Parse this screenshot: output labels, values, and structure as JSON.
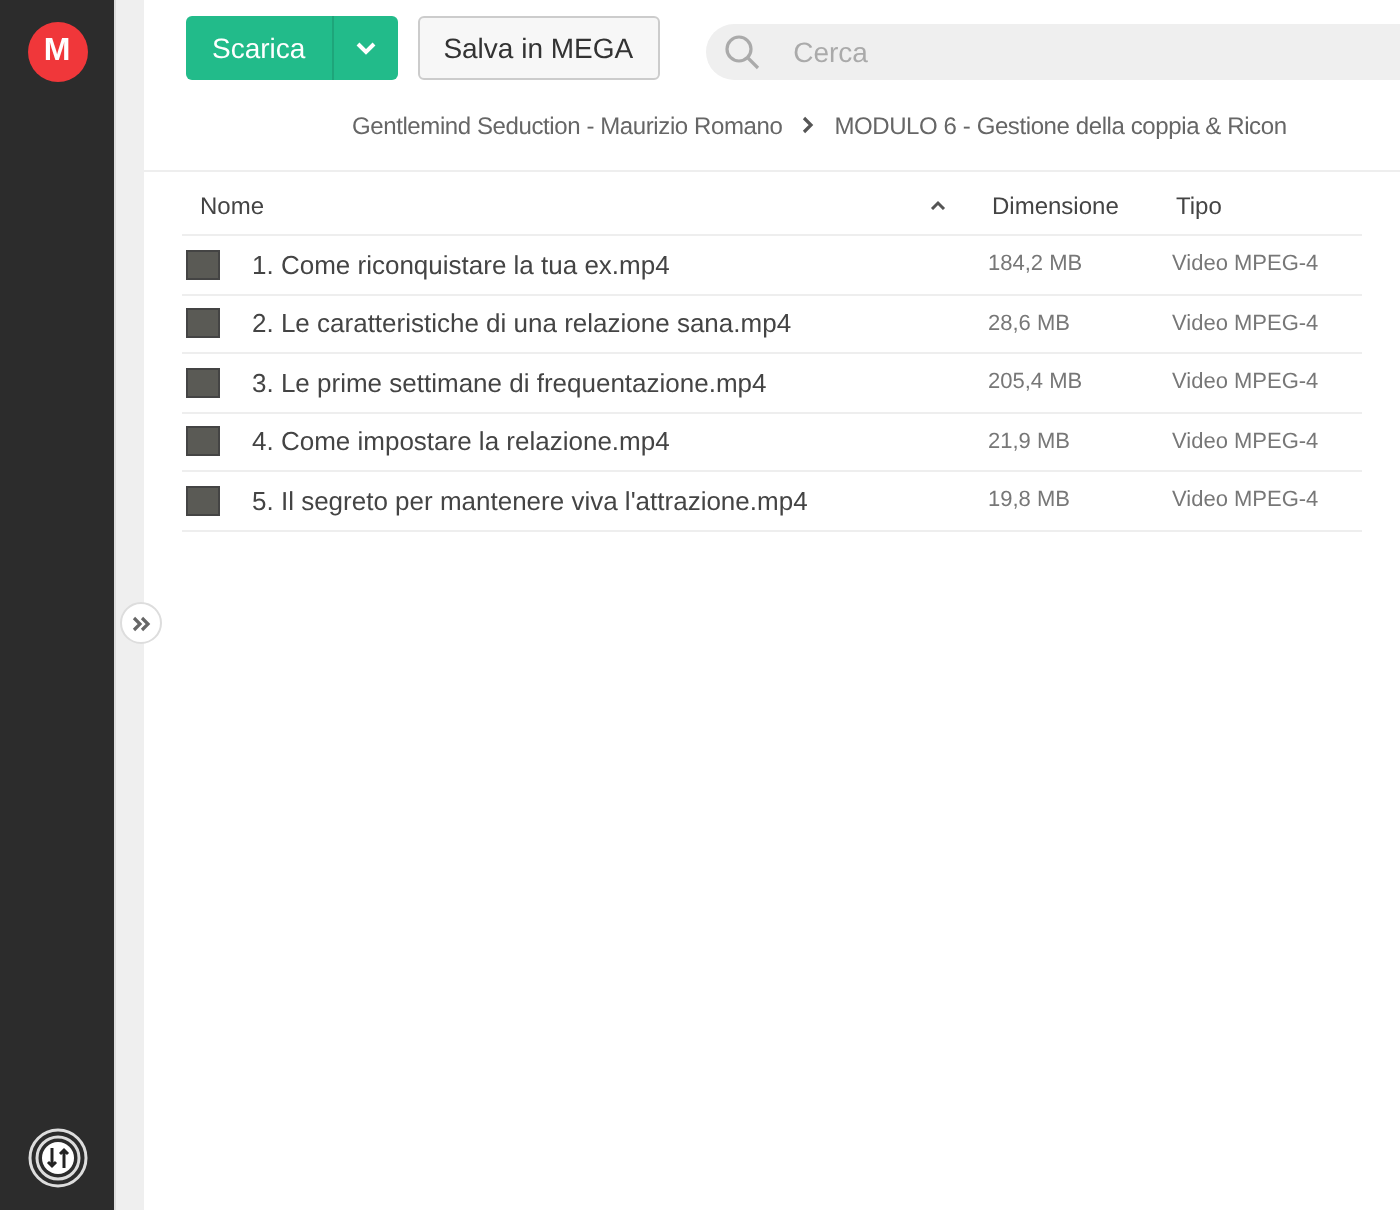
{
  "sidebar": {
    "logo": "M"
  },
  "toolbar": {
    "download_button": "Scarica",
    "save_button": "Salva in MEGA",
    "search": {
      "placeholder": "Cerca"
    }
  },
  "breadcrumb": [
    "Gentlemind Seduction - Maurizio Romano",
    "MODULO 6 - Gestione della coppia & Ricon"
  ],
  "table": {
    "columns": [
      "Nome",
      "Dimensione",
      "Tipo"
    ],
    "rows": [
      {
        "name": "1. Come riconquistare la tua ex.mp4",
        "size": "184,2 MB",
        "type": "Video MPEG-4"
      },
      {
        "name": "2. Le caratteristiche di una relazione sana.mp4",
        "size": "28,6 MB",
        "type": "Video MPEG-4"
      },
      {
        "name": "3. Le prime settimane di frequentazione.mp4",
        "size": "205,4 MB",
        "type": "Video MPEG-4"
      },
      {
        "name": "4. Come impostare la relazione.mp4",
        "size": "21,9 MB",
        "type": "Video MPEG-4"
      },
      {
        "name": "5. Il segreto per mantenere viva l'attrazione.mp4",
        "size": "19,8 MB",
        "type": "Video MPEG-4"
      }
    ]
  }
}
